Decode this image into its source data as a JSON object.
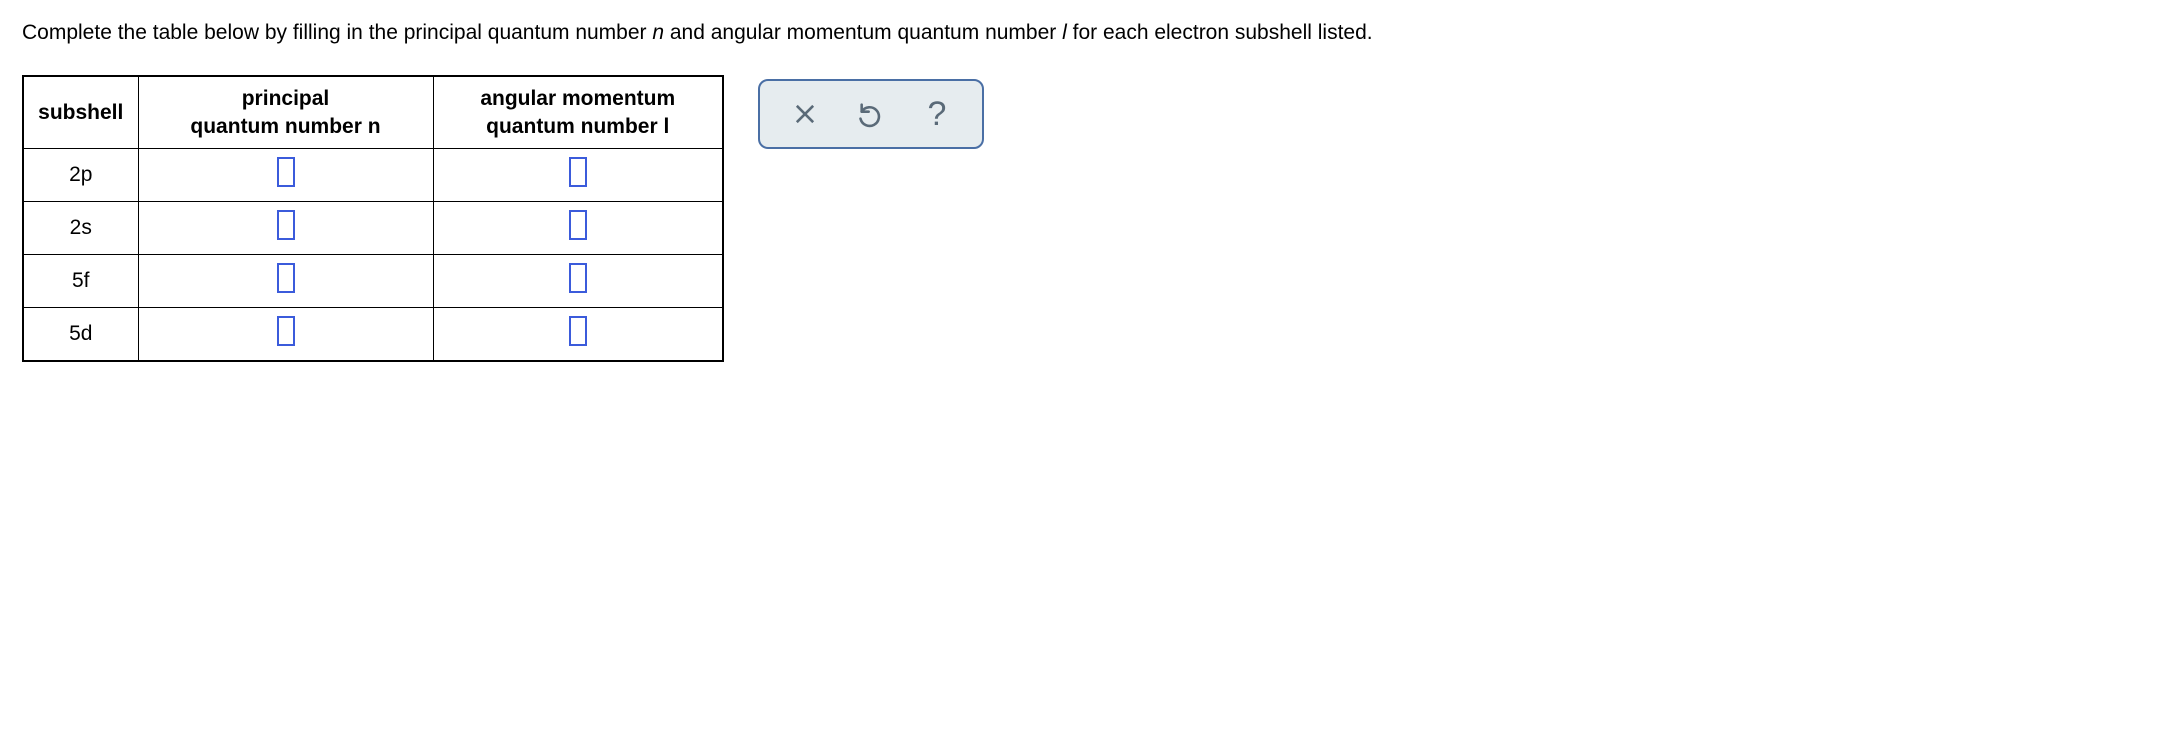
{
  "question": {
    "prefix": "Complete the table below by filling in the principal quantum number ",
    "var_n": "n",
    "mid": " and angular momentum quantum number ",
    "var_l": "l",
    "suffix": " for each electron subshell listed."
  },
  "table": {
    "headers": {
      "subshell": "subshell",
      "principal_line1": "principal",
      "principal_line2_pre": "quantum number ",
      "principal_line2_var": "n",
      "angular_line1": "angular momentum",
      "angular_line2_pre": "quantum number ",
      "angular_line2_var": "l"
    },
    "rows": [
      {
        "subshell": "2p",
        "n": "",
        "l": ""
      },
      {
        "subshell": "2s",
        "n": "",
        "l": ""
      },
      {
        "subshell": "5f",
        "n": "",
        "l": ""
      },
      {
        "subshell": "5d",
        "n": "",
        "l": ""
      }
    ]
  },
  "toolbar": {
    "clear": "clear",
    "reset": "reset",
    "help": "?"
  }
}
